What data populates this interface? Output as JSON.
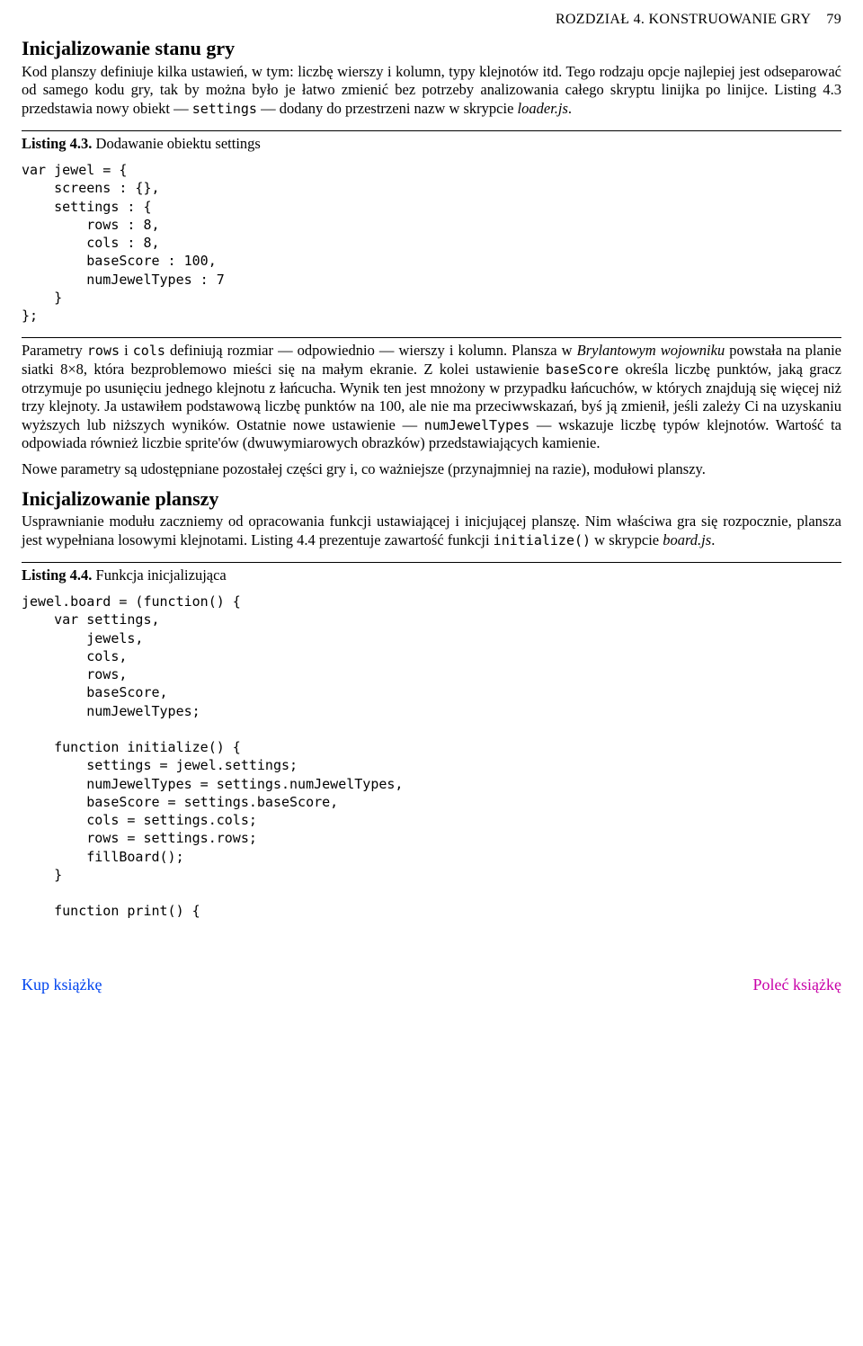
{
  "header": {
    "chapter": "ROZDZIAŁ 4. KONSTRUOWANIE GRY",
    "page": "79"
  },
  "section1": {
    "title": "Inicjalizowanie stanu gry",
    "p1_a": "Kod planszy definiuje kilka ustawień, w tym: liczbę wierszy i kolumn, typy klejnotów itd. Tego rodzaju opcje najlepiej jest odseparować od samego kodu gry, tak by można było je łatwo zmienić bez potrzeby analizowania całego skryptu linijka po linijce. Listing 4.3 przedstawia nowy obiekt — ",
    "p1_code": "settings",
    "p1_b": " — dodany do przestrzeni nazw w skrypcie ",
    "p1_em": "loader.js",
    "p1_c": "."
  },
  "listing43": {
    "label": "Listing 4.3.",
    "caption": " Dodawanie obiektu settings",
    "code": "var jewel = {\n    screens : {},\n    settings : {\n        rows : 8,\n        cols : 8,\n        baseScore : 100,\n        numJewelTypes : 7\n    }\n};"
  },
  "params": {
    "p_a": "Parametry ",
    "c1": "rows",
    "p_b": " i ",
    "c2": "cols",
    "p_c": " definiują rozmiar — odpowiednio — wierszy i kolumn. Plansza w ",
    "em1": "Brylantowym wojowniku",
    "p_d": " powstała na planie siatki 8×8, która bezproblemowo mieści się na małym ekranie. Z kolei ustawienie ",
    "c3": "baseScore",
    "p_e": " określa liczbę punktów, jaką gracz otrzymuje po usunięciu jednego klejnotu z łańcucha. Wynik ten jest mnożony w przypadku łańcuchów, w których znajdują się więcej niż trzy klejnoty. Ja ustawiłem podstawową liczbę punktów na 100, ale nie ma przeciwwskazań, byś ją zmienił, jeśli zależy Ci na uzyskaniu wyższych lub niższych wyników. Ostatnie nowe ustawienie — ",
    "c4": "numJewelTypes",
    "p_f": " — wskazuje liczbę typów klejnotów. Wartość ta odpowiada również liczbie sprite'ów (dwuwymiarowych obrazków) przedstawiających kamienie."
  },
  "params2": "Nowe parametry są udostępniane pozostałej części gry i, co ważniejsze (przynajmniej na razie), modułowi planszy.",
  "section2": {
    "title": "Inicjalizowanie planszy",
    "p_a": "Usprawnianie modułu zaczniemy od opracowania funkcji ustawiającej i inicjującej planszę. Nim właściwa gra się rozpocznie, plansza jest wypełniana losowymi klejnotami. Listing 4.4 prezentuje zawartość funkcji ",
    "c1": "initialize()",
    "p_b": " w skrypcie ",
    "em1": "board.js",
    "p_c": "."
  },
  "listing44": {
    "label": "Listing 4.4.",
    "caption": " Funkcja inicjalizująca",
    "code": "jewel.board = (function() {\n    var settings,\n        jewels,\n        cols,\n        rows,\n        baseScore,\n        numJewelTypes;\n\n    function initialize() {\n        settings = jewel.settings;\n        numJewelTypes = settings.numJewelTypes,\n        baseScore = settings.baseScore,\n        cols = settings.cols;\n        rows = settings.rows;\n        fillBoard();\n    }\n\n    function print() {"
  },
  "footer": {
    "buy": "Kup książkę",
    "recommend": "Poleć książkę"
  }
}
